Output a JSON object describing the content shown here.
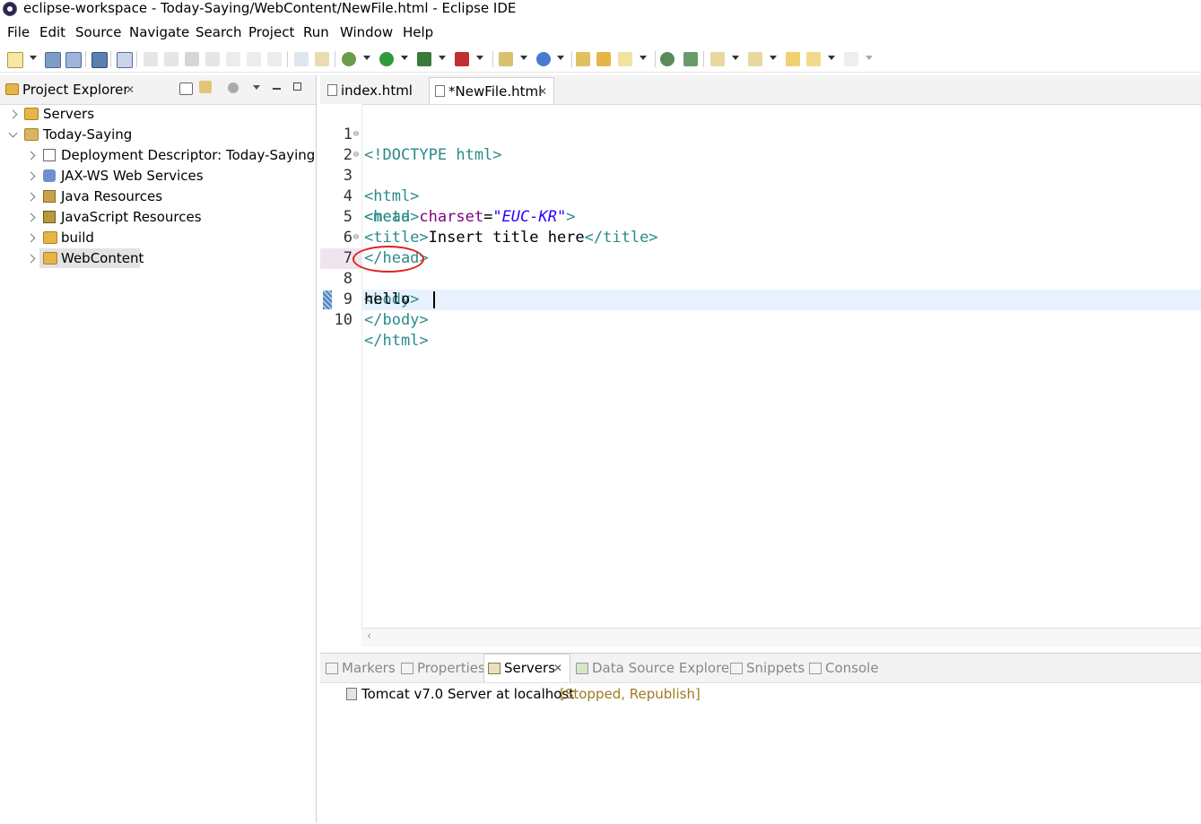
{
  "window": {
    "title": "eclipse-workspace - Today-Saying/WebContent/NewFile.html - Eclipse IDE"
  },
  "menu": [
    "File",
    "Edit",
    "Source",
    "Navigate",
    "Search",
    "Project",
    "Run",
    "Window",
    "Help"
  ],
  "project_explorer": {
    "title": "Project Explorer",
    "items": [
      {
        "label": "Servers",
        "level": 0,
        "expanded": false
      },
      {
        "label": "Today-Saying",
        "level": 0,
        "expanded": true
      },
      {
        "label": "Deployment Descriptor: Today-Saying",
        "level": 1,
        "expanded": false
      },
      {
        "label": "JAX-WS Web Services",
        "level": 1,
        "expanded": false
      },
      {
        "label": "Java Resources",
        "level": 1,
        "expanded": false
      },
      {
        "label": "JavaScript Resources",
        "level": 1,
        "expanded": false
      },
      {
        "label": "build",
        "level": 1,
        "expanded": false
      },
      {
        "label": "WebContent",
        "level": 1,
        "expanded": false,
        "selected": true
      }
    ]
  },
  "editor": {
    "tabs": [
      {
        "label": "index.html",
        "active": false
      },
      {
        "label": "*NewFile.html",
        "active": true
      }
    ],
    "line_numbers": [
      "1",
      "2",
      "3",
      "4",
      "5",
      "6",
      "7",
      "8",
      "9",
      "10"
    ],
    "lines": [
      "<!DOCTYPE html>",
      "<html>",
      "<head>",
      "<meta charset=\"EUC-KR\">",
      "<title>Insert title here</title>",
      "</head>",
      "<body>",
      "hello",
      "</body>",
      "</html>"
    ],
    "current_line": 10,
    "highlighted_text": "hello"
  },
  "bottom_panel": {
    "tabs": [
      {
        "label": "Markers",
        "active": false
      },
      {
        "label": "Properties",
        "active": false
      },
      {
        "label": "Servers",
        "active": true
      },
      {
        "label": "Data Source Explorer",
        "active": false
      },
      {
        "label": "Snippets",
        "active": false
      },
      {
        "label": "Console",
        "active": false
      }
    ],
    "server": {
      "name": "Tomcat v7.0 Server at localhost",
      "status": "[Stopped, Republish]"
    }
  }
}
